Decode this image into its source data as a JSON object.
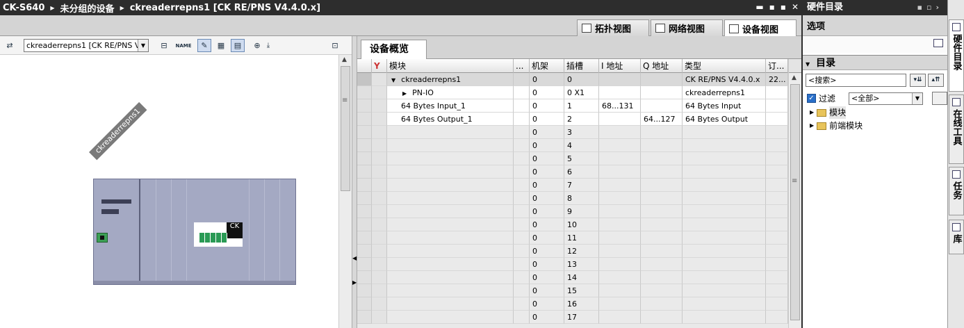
{
  "titlebar": {
    "crumbs": [
      "CK-S640",
      "未分组的设备",
      "ckreaderrepns1 [CK RE/PNS V4.4.0.x]"
    ],
    "controls": [
      "▬",
      "▪",
      "▪",
      "✕"
    ]
  },
  "view_tabs": [
    {
      "label": "拓扑视图",
      "icon": "topology-icon"
    },
    {
      "label": "网络视图",
      "icon": "network-icon"
    },
    {
      "label": "设备视图",
      "icon": "device-icon"
    }
  ],
  "toolbar": {
    "device_select": "ckreaderrepns1 [CK RE/PNS V",
    "name_icon_text": "NAME"
  },
  "canvas": {
    "device_label": "ckreaderrepns1",
    "logo_text": "CK"
  },
  "overview": {
    "tab_label": "设备概览",
    "columns": [
      "模块",
      "...",
      "机架",
      "插槽",
      "I 地址",
      "Q 地址",
      "类型",
      "订..."
    ],
    "rows": [
      {
        "module": "ckreaderrepns1",
        "rack": "0",
        "slot": "0",
        "i_addr": "",
        "q_addr": "",
        "type": "CK RE/PNS V4.4.0.x",
        "order": "22..."
      },
      {
        "module": "PN-IO",
        "rack": "0",
        "slot": "0 X1",
        "i_addr": "",
        "q_addr": "",
        "type": "ckreaderrepns1",
        "order": ""
      },
      {
        "module": "64 Bytes Input_1",
        "rack": "0",
        "slot": "1",
        "i_addr": "68...131",
        "q_addr": "",
        "type": "64 Bytes Input",
        "order": ""
      },
      {
        "module": "64 Bytes Output_1",
        "rack": "0",
        "slot": "2",
        "i_addr": "",
        "q_addr": "64...127",
        "type": "64 Bytes Output",
        "order": ""
      },
      {
        "module": "",
        "rack": "0",
        "slot": "3",
        "i_addr": "",
        "q_addr": "",
        "type": "",
        "order": ""
      },
      {
        "module": "",
        "rack": "0",
        "slot": "4",
        "i_addr": "",
        "q_addr": "",
        "type": "",
        "order": ""
      },
      {
        "module": "",
        "rack": "0",
        "slot": "5",
        "i_addr": "",
        "q_addr": "",
        "type": "",
        "order": ""
      },
      {
        "module": "",
        "rack": "0",
        "slot": "6",
        "i_addr": "",
        "q_addr": "",
        "type": "",
        "order": ""
      },
      {
        "module": "",
        "rack": "0",
        "slot": "7",
        "i_addr": "",
        "q_addr": "",
        "type": "",
        "order": ""
      },
      {
        "module": "",
        "rack": "0",
        "slot": "8",
        "i_addr": "",
        "q_addr": "",
        "type": "",
        "order": ""
      },
      {
        "module": "",
        "rack": "0",
        "slot": "9",
        "i_addr": "",
        "q_addr": "",
        "type": "",
        "order": ""
      },
      {
        "module": "",
        "rack": "0",
        "slot": "10",
        "i_addr": "",
        "q_addr": "",
        "type": "",
        "order": ""
      },
      {
        "module": "",
        "rack": "0",
        "slot": "11",
        "i_addr": "",
        "q_addr": "",
        "type": "",
        "order": ""
      },
      {
        "module": "",
        "rack": "0",
        "slot": "12",
        "i_addr": "",
        "q_addr": "",
        "type": "",
        "order": ""
      },
      {
        "module": "",
        "rack": "0",
        "slot": "13",
        "i_addr": "",
        "q_addr": "",
        "type": "",
        "order": ""
      },
      {
        "module": "",
        "rack": "0",
        "slot": "14",
        "i_addr": "",
        "q_addr": "",
        "type": "",
        "order": ""
      },
      {
        "module": "",
        "rack": "0",
        "slot": "15",
        "i_addr": "",
        "q_addr": "",
        "type": "",
        "order": ""
      },
      {
        "module": "",
        "rack": "0",
        "slot": "16",
        "i_addr": "",
        "q_addr": "",
        "type": "",
        "order": ""
      },
      {
        "module": "",
        "rack": "0",
        "slot": "17",
        "i_addr": "",
        "q_addr": "",
        "type": "",
        "order": ""
      }
    ]
  },
  "hw_catalog": {
    "title": "硬件目录",
    "options_label": "选项",
    "catalog_label": "目录",
    "search_value": "<搜索>",
    "filter_label": "过滤",
    "filter_value": "<全部>",
    "tree": [
      "模块",
      "前端模块"
    ]
  },
  "side_tabs": [
    "硬件目录",
    "在线工具",
    "任务",
    "库"
  ],
  "colors": {
    "title_bg": "#2d2d2d",
    "rack": "#a4a9c3",
    "profinet_green": "#2a9a55",
    "accent_blue": "#2a6fc9"
  }
}
